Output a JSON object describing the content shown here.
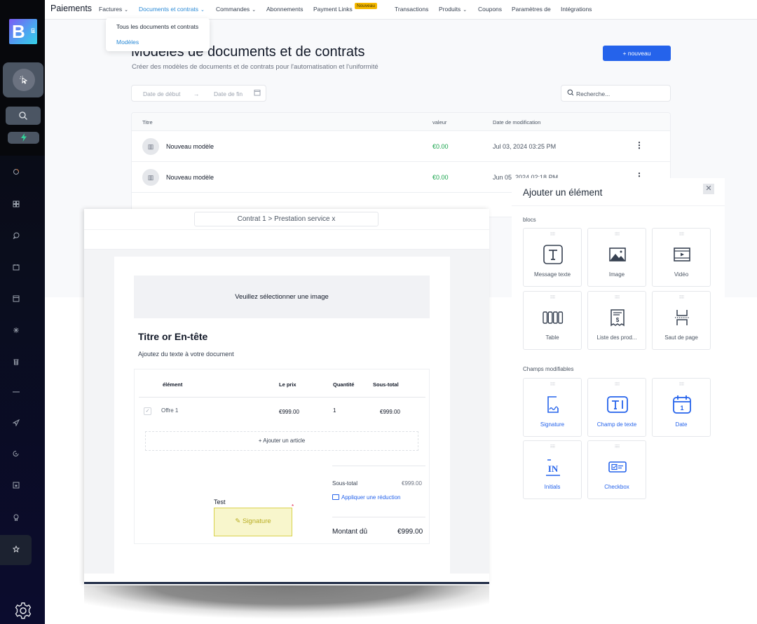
{
  "rail": {
    "logo": {
      "letter": "B",
      "sup": "4",
      "sub": "E"
    },
    "top_buttons": [
      "cursor-click-icon",
      "search-icon",
      "lightning-icon"
    ],
    "icons": [
      "circle-icon",
      "grid-icon",
      "chat-icon",
      "calendar-icon",
      "archive-icon",
      "sparkle-icon",
      "trash-icon",
      "minus-icon",
      "send-icon",
      "refresh-icon",
      "calendar-box-icon",
      "award-icon",
      "star-icon"
    ],
    "active_icon": "star-icon",
    "settings_icon": "gear-icon"
  },
  "topnav": {
    "brand": "Paiements",
    "items": [
      {
        "label": "Factures",
        "dropdown": true
      },
      {
        "label": "Documents et contrats",
        "dropdown": true,
        "active": true
      },
      {
        "label": "Commandes",
        "dropdown": true
      },
      {
        "label": "Abonnements"
      },
      {
        "label": "Payment Links",
        "badge": "Nouveau"
      },
      {
        "label": "Transactions"
      },
      {
        "label": "Produits",
        "dropdown": true
      },
      {
        "label": "Coupons"
      },
      {
        "label": "Paramètres de"
      },
      {
        "label": "Intégrations"
      }
    ],
    "dropdown_menu": [
      "Tous les documents et contrats",
      "Modèles"
    ],
    "dropdown_selected": "Modèles"
  },
  "page": {
    "title": "Modèles de documents et de contrats",
    "subtitle": "Créer des modèles de documents et de contrats pour l'automatisation et l'uniformité",
    "new_button": "+ nouveau",
    "date_start_placeholder": "Date de début",
    "date_arrow": "→",
    "date_end_placeholder": "Date de fin",
    "search_placeholder": "Recherche..."
  },
  "table": {
    "columns": [
      "Titre",
      "valeur",
      "Date de modification"
    ],
    "rows": [
      {
        "title": "Nouveau modèle",
        "value": "€0.00",
        "date": "Jul 03, 2024 03:25 PM"
      },
      {
        "title": "Nouveau modèle",
        "value": "€0.00",
        "date": "Jun 05, 2024 02:18 PM"
      }
    ]
  },
  "panel": {
    "title": "Ajouter un élément",
    "close": "✕",
    "sections": [
      {
        "label": "blocs",
        "items": [
          {
            "label": "Message texte",
            "icon": "text-icon"
          },
          {
            "label": "Image",
            "icon": "image-icon"
          },
          {
            "label": "Vidéo",
            "icon": "video-icon"
          },
          {
            "label": "Table",
            "icon": "table-icon"
          },
          {
            "label": "Liste des prod...",
            "icon": "receipt-icon"
          },
          {
            "label": "Saut de page",
            "icon": "page-break-icon"
          }
        ]
      },
      {
        "label": "Champs modifiables",
        "items": [
          {
            "label": "Signature",
            "icon": "signature-icon"
          },
          {
            "label": "Champ de texte",
            "icon": "text-field-icon"
          },
          {
            "label": "Date",
            "icon": "date-icon"
          },
          {
            "label": "Initials",
            "icon": "initials-icon"
          },
          {
            "label": "Checkbox",
            "icon": "checkbox-icon"
          }
        ]
      }
    ]
  },
  "editor": {
    "breadcrumb": "Contrat 1 > Prestation service x",
    "image_placeholder": "Veuillez sélectionner une image",
    "heading": "Titre or En-tête",
    "paragraph": "Ajoutez du texte à votre document",
    "quote": {
      "columns": [
        "élément",
        "Le prix",
        "Quantité",
        "Sous-total"
      ],
      "items": [
        {
          "name": "Offre 1",
          "price": "€999.00",
          "qty": "1",
          "subtotal": "€999.00",
          "checked": true
        }
      ],
      "add_item": "+ Ajouter un article",
      "subtotal_label": "Sous-total",
      "subtotal_value": "€999.00",
      "discount_link": "Appliquer une réduction",
      "due_label": "Montant dû",
      "due_value": "€999.00"
    },
    "signature": {
      "label": "Test",
      "field": "Signature",
      "required_mark": "*"
    }
  },
  "colors": {
    "accent": "#2563eb",
    "nav_active": "#2a8ad6",
    "value_green": "#16a34a",
    "badge": "#f5b800",
    "signature_fill": "#f8f6cc",
    "signature_border": "#d8d24a"
  }
}
